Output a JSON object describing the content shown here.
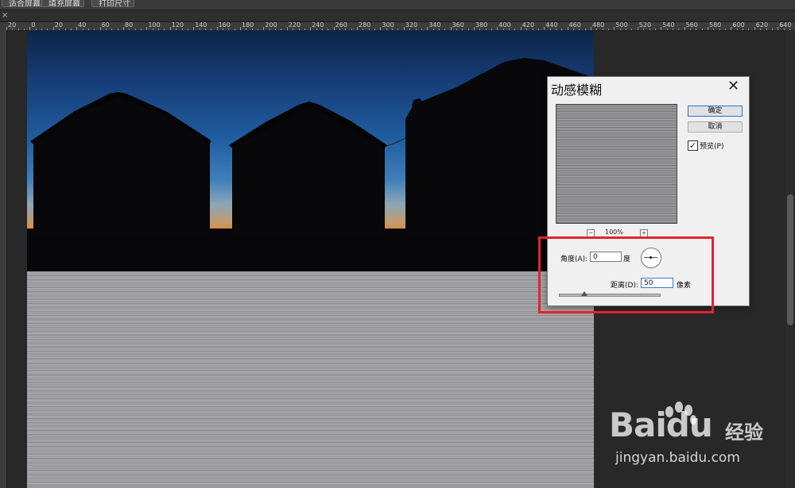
{
  "top_buttons": [
    "适合屏幕",
    "填充屏幕",
    "打印尺寸"
  ],
  "tab": {
    "close": "×"
  },
  "ruler": {
    "ticks": [
      "20",
      "0",
      "20",
      "40",
      "60",
      "80",
      "100",
      "120",
      "140",
      "160",
      "180",
      "200",
      "220",
      "240",
      "260",
      "280",
      "300",
      "320",
      "340",
      "360",
      "380",
      "400",
      "420",
      "440",
      "460",
      "480",
      "500",
      "520",
      "540",
      "560",
      "580",
      "600",
      "620",
      "640"
    ]
  },
  "dialog": {
    "title": "动感模糊",
    "close": "✕",
    "ok": "确定",
    "cancel": "取消",
    "preview_checked": "✓",
    "preview_label": "预览(P)",
    "zoom_minus": "−",
    "zoom_plus": "+",
    "zoom": "100%",
    "angle_label": "角度(A):",
    "angle_value": "0",
    "angle_unit": "度",
    "distance_label": "距离(D):",
    "distance_value": "50",
    "distance_unit": "像素",
    "distance_slider": 0.25
  },
  "watermark": {
    "logo": "Bai",
    "logo2": "du",
    "text": "经验",
    "url": "jingyan.baidu.com"
  }
}
